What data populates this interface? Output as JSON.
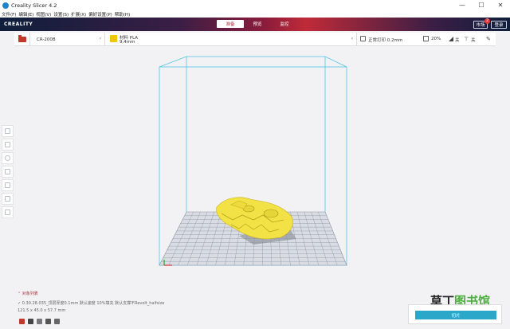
{
  "window": {
    "title": "Creality Slicer 4.2",
    "controls": [
      "—",
      "☐",
      "✕"
    ]
  },
  "menu": [
    "文件(F)",
    "编辑(E)",
    "视图(V)",
    "设置(S)",
    "扩展(X)",
    "偏好设置(P)",
    "帮助(H)"
  ],
  "header": {
    "logo": "CREALITY",
    "stages": [
      "准备",
      "预览",
      "监控"
    ],
    "active_stage": 0,
    "market_label": "市场",
    "login_label": "登录",
    "notification_count": "2"
  },
  "toolbar": {
    "printer": "CR-200B",
    "material_label": "材料 PLA",
    "material_size": "9.4mm",
    "profile": "正常打印 0.2mm",
    "infill": "20%",
    "support": "关",
    "adhesion": "关"
  },
  "left_tools": [
    "move-tool",
    "scale-tool",
    "rotate-tool",
    "mirror-tool",
    "per-model-settings-tool",
    "support-blocker-tool",
    "custom-support-tool"
  ],
  "object_list": {
    "title": "对象列表",
    "file": "0.30.28.035_顶层厚度0.1mm 默认速度 10%填充 默认支撑不Revolt_halfsize",
    "dims": "121.5 x 45.0 x 57.7 mm"
  },
  "slice_button": "切片",
  "watermark": {
    "part1": "草丁",
    "part2": "图书馆"
  },
  "colors": {
    "accent": "#b02a3a",
    "slice": "#2aa7c9",
    "model": "#f2e246",
    "volume_outline": "#52c3e3"
  }
}
